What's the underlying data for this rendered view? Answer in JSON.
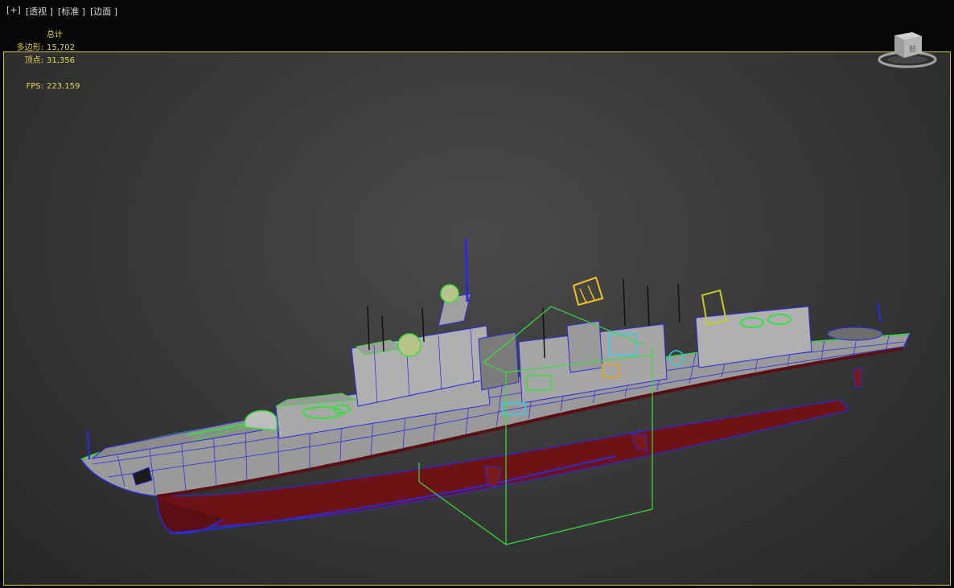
{
  "viewport": {
    "labels": [
      "[+]",
      "[透视 ]",
      "[标准 ]",
      "[边面 ]"
    ]
  },
  "stats": {
    "header": "总计",
    "polygons_label": "多边形:",
    "polygons_value": "15,702",
    "vertices_label": "顶点:",
    "vertices_value": "31,356",
    "fps_label": "FPS:",
    "fps_value": "223.159"
  },
  "viewcube": {
    "face_label": "前"
  },
  "colors": {
    "frame": "#d6c64a",
    "stats_text": "#e6d84a",
    "wire_blue": "#2a2adf",
    "wire_green": "#34e03a",
    "hull_red": "#7a1518",
    "hull_grey": "#9a9a9a"
  }
}
